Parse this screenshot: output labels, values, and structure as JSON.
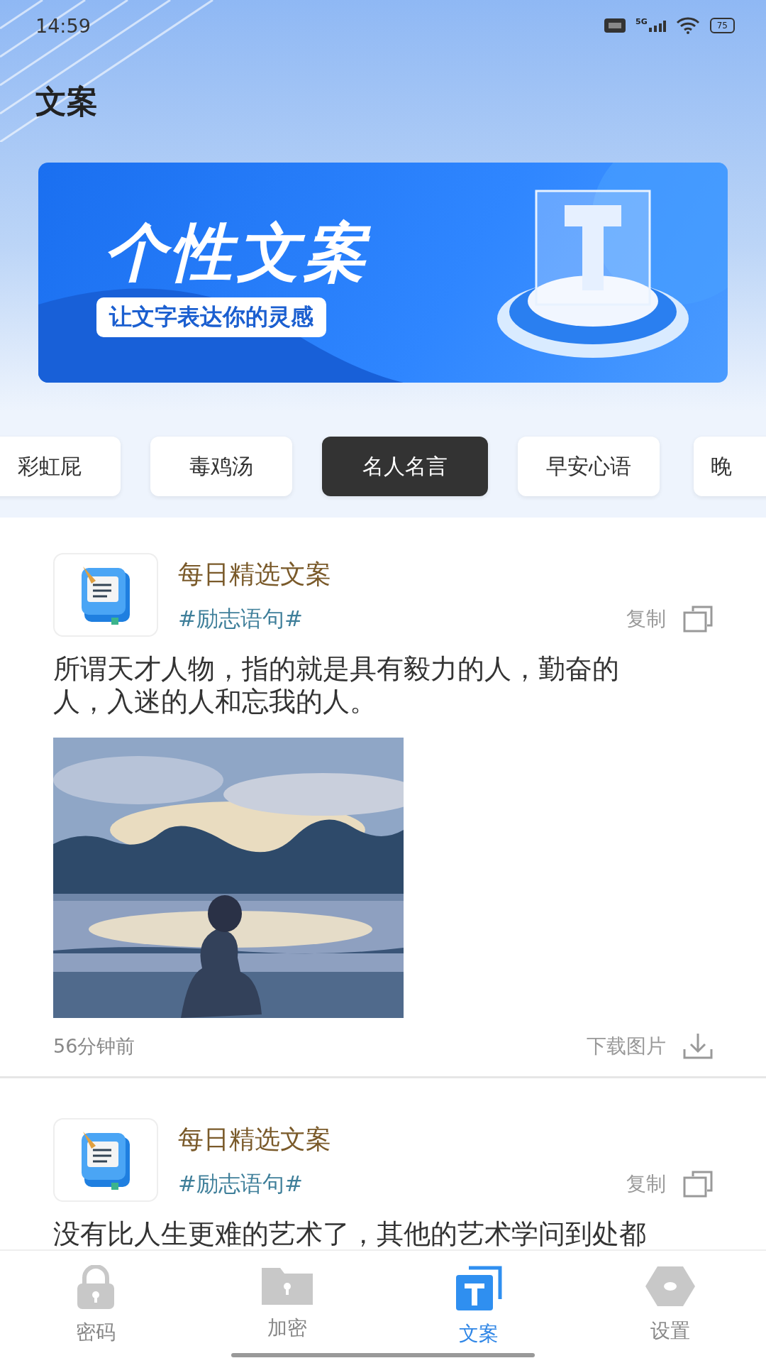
{
  "status_bar": {
    "time": "14:59",
    "network": "5G",
    "battery": "75"
  },
  "header": {
    "title": "文案"
  },
  "banner": {
    "title": "个性文案",
    "subtitle": "让文字表达你的灵感"
  },
  "categories": [
    {
      "label": "彩虹屁",
      "selected": false
    },
    {
      "label": "毒鸡汤",
      "selected": false
    },
    {
      "label": "名人名言",
      "selected": true
    },
    {
      "label": "早安心语",
      "selected": false
    },
    {
      "label": "晚",
      "selected": false
    }
  ],
  "posts": [
    {
      "title": "每日精选文案",
      "tag": "#励志语句#",
      "copy": "复制",
      "text": "所谓天才人物，指的就是具有毅力的人，勤奋的人，入迷的人和忘我的人。",
      "time": "56分钟前",
      "download": "下载图片"
    },
    {
      "title": "每日精选文案",
      "tag": "#励志语句#",
      "copy": "复制",
      "text": "没有比人生更难的艺术了，其他的艺术学问到处都"
    }
  ],
  "nav": [
    {
      "label": "密码",
      "selected": false
    },
    {
      "label": "加密",
      "selected": false
    },
    {
      "label": "文案",
      "selected": true
    },
    {
      "label": "设置",
      "selected": false
    }
  ]
}
